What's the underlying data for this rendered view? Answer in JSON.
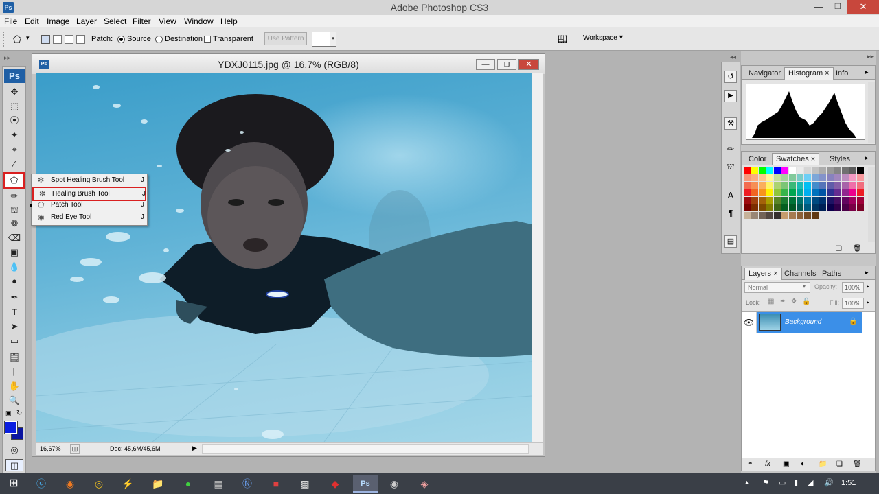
{
  "window": {
    "title": "Adobe Photoshop CS3",
    "app_icon": "Ps"
  },
  "menu": [
    "File",
    "Edit",
    "Image",
    "Layer",
    "Select",
    "Filter",
    "View",
    "Window",
    "Help"
  ],
  "options_bar": {
    "patch_label": "Patch:",
    "source_label": "Source",
    "destination_label": "Destination",
    "transparent_label": "Transparent",
    "use_pattern_label": "Use Pattern",
    "workspace_label": "Workspace"
  },
  "toolbox": {
    "logo": "Ps",
    "foreground_color": "#0a1ee0",
    "background_color": "#0a14a0"
  },
  "tool_flyout": {
    "items": [
      {
        "label": "Spot Healing Brush Tool",
        "key": "J",
        "icon": "spot-healing-brush-icon",
        "highlighted": false,
        "current": false
      },
      {
        "label": "Healing Brush Tool",
        "key": "J",
        "icon": "healing-brush-icon",
        "highlighted": true,
        "current": false
      },
      {
        "label": "Patch Tool",
        "key": "J",
        "icon": "patch-icon",
        "highlighted": false,
        "current": true
      },
      {
        "label": "Red Eye Tool",
        "key": "J",
        "icon": "red-eye-icon",
        "highlighted": false,
        "current": false
      }
    ]
  },
  "document": {
    "title": "YDXJ0115.jpg @ 16,7% (RGB/8)",
    "zoom": "16,67%",
    "doc_info": "Doc: 45,6M/45,6M"
  },
  "panels": {
    "top_tabs": [
      "Navigator",
      "Histogram",
      "Info"
    ],
    "top_active": "Histogram",
    "mid_tabs": [
      "Color",
      "Swatches",
      "Styles"
    ],
    "mid_active": "Swatches",
    "layers_tabs": [
      "Layers",
      "Channels",
      "Paths"
    ],
    "layers_active": "Layers",
    "blend_mode": "Normal",
    "opacity_label": "Opacity:",
    "opacity": "100%",
    "lock_label": "Lock:",
    "fill_label": "Fill:",
    "fill": "100%",
    "layer_name": "Background",
    "highlight_color": "#3b8fe8"
  },
  "taskbar": {
    "clock": "1:51"
  }
}
